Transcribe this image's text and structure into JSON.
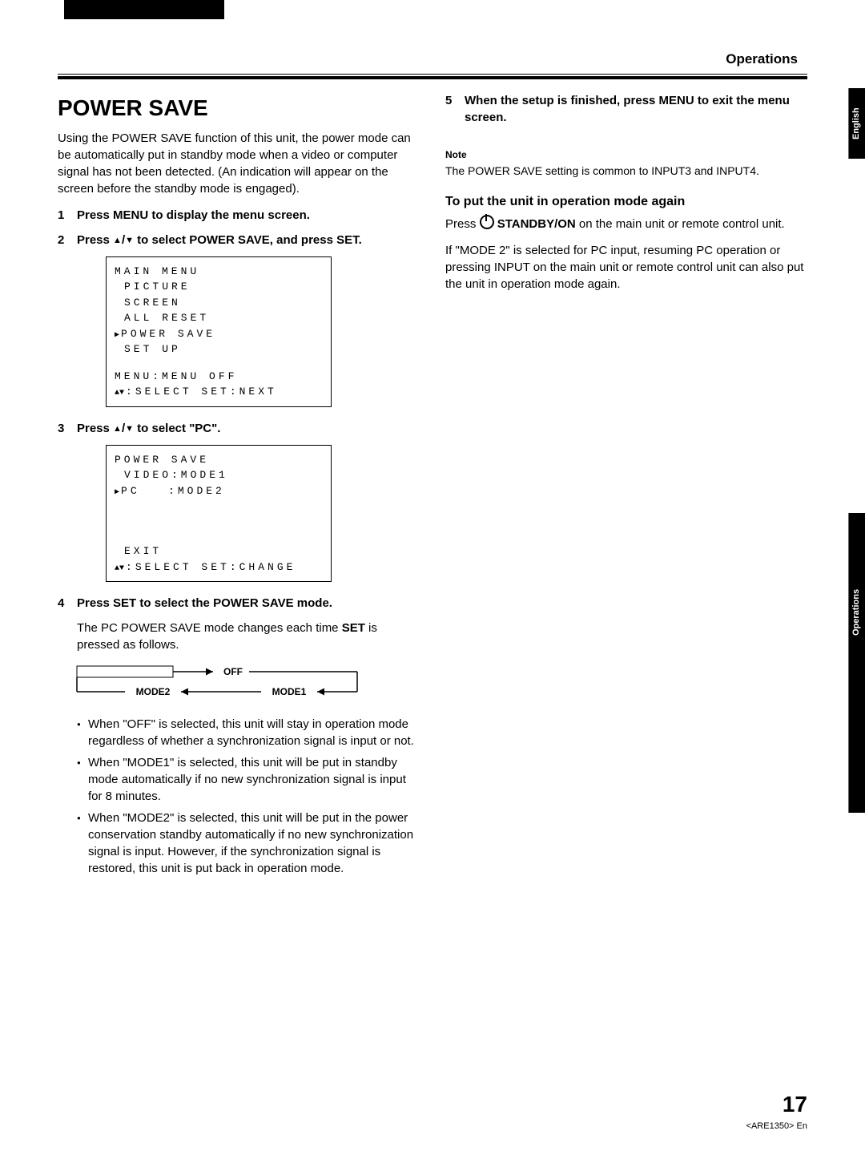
{
  "header": {
    "section": "Operations"
  },
  "sideTabs": {
    "lang": "English",
    "section": "Operations"
  },
  "title": "POWER SAVE",
  "intro": "Using the POWER SAVE function of this unit, the power mode can be automatically put in standby mode when a video or computer signal has not been detected. (An indication will appear on the screen before the standby mode is engaged).",
  "steps": {
    "s1": "Press MENU to display the menu screen.",
    "s2_pre": "Press ",
    "s2_post": " to select POWER SAVE, and press SET.",
    "s3_pre": "Press ",
    "s3_post": " to select \"PC\".",
    "s4": "Press SET to select the POWER SAVE mode.",
    "s4_body_a": "The PC POWER SAVE mode changes each time ",
    "s4_body_b": "SET",
    "s4_body_c": " is pressed as follows.",
    "s5": "When the setup is finished, press MENU to exit the menu screen."
  },
  "osd1": {
    "l1": "MAIN MENU",
    "l2": "PICTURE",
    "l3": "SCREEN",
    "l4": "ALL RESET",
    "l5": "POWER SAVE",
    "l6": "SET UP",
    "l7": "MENU:MENU OFF",
    "l8": ":SELECT SET:NEXT"
  },
  "osd2": {
    "l1": "POWER SAVE",
    "l2": "VIDEO:MODE1",
    "l3_a": "PC",
    "l3_b": ":MODE2",
    "l4": "EXIT",
    "l5": ":SELECT SET:CHANGE"
  },
  "cycle": {
    "off": "OFF",
    "mode1": "MODE1",
    "mode2": "MODE2"
  },
  "bullets": {
    "b1": "When \"OFF\" is selected, this unit will stay in operation mode regardless of whether a synchronization signal is input or not.",
    "b2": "When \"MODE1\" is selected, this unit will be put in standby mode automatically if no new synchronization signal is input for 8 minutes.",
    "b3": "When \"MODE2\" is selected, this unit will be put in the power conservation standby automatically if no new synchronization signal is input. However, if the synchronization signal is restored, this unit is put back in operation mode."
  },
  "note": {
    "label": "Note",
    "text": "The POWER SAVE setting is common to INPUT3 and INPUT4."
  },
  "resume": {
    "heading": "To put the unit in operation mode again",
    "p1_a": "Press ",
    "p1_b": " STANDBY/ON",
    "p1_c": " on the main unit or remote control unit.",
    "p2": "If \"MODE 2\" is selected for PC input, resuming PC operation or pressing INPUT on the main unit or remote control unit can also put the unit in operation mode again."
  },
  "pageNumber": "17",
  "docCode": "<ARE1350> En"
}
